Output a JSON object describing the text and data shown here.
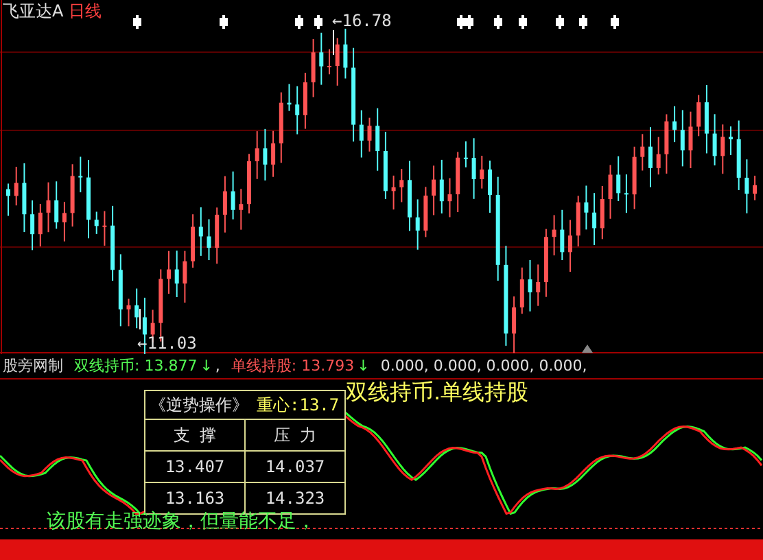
{
  "chart": {
    "stock_name": "飞亚达A",
    "period": "日线",
    "high_label": "←16.78",
    "low_label": "←11.03"
  },
  "indicator": {
    "name": "股旁网制",
    "values": [
      {
        "label": "双线持币:",
        "value": "13.877",
        "arrow": "↓",
        "separator": ",",
        "color": "#54fc54"
      },
      {
        "label": "单线持股:",
        "value": "13.793",
        "arrow": "↓",
        "color": "#fc5454"
      }
    ],
    "extra_values": "0.000, 0.000, 0.000, 0.000,"
  },
  "table": {
    "title": "《逆势操作》",
    "center": "重心:13.7",
    "columns": [
      "支 撑",
      "压 力"
    ],
    "rows": [
      [
        "13.407",
        "14.037"
      ],
      [
        "13.163",
        "14.323"
      ]
    ]
  },
  "signal_text": "双线持币.单线持股",
  "comment": "该股有走强迹象，但量能不足，"
}
